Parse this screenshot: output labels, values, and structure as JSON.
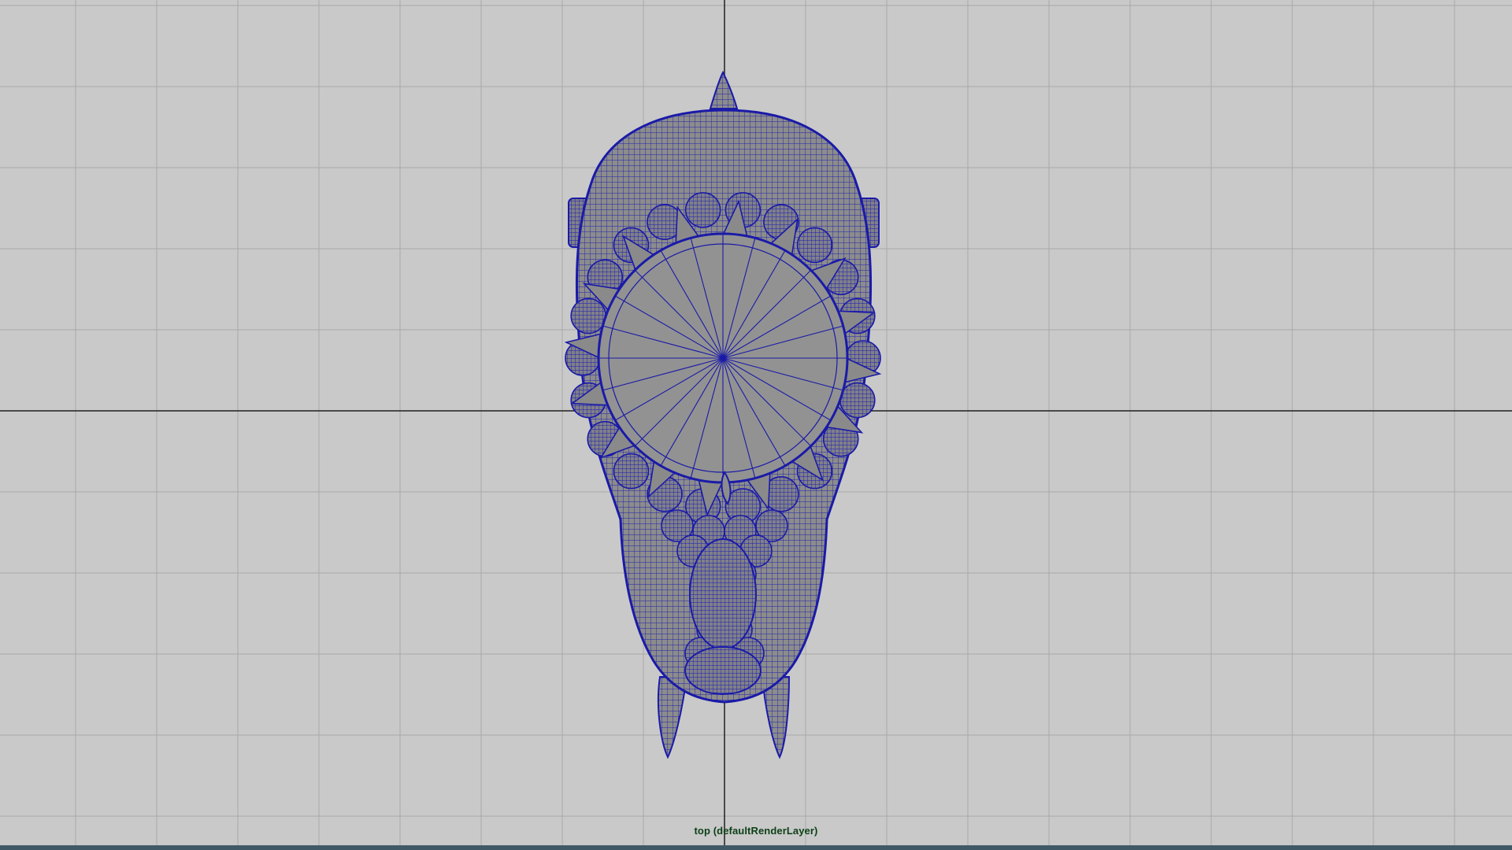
{
  "viewport": {
    "camera_label": "top (defaultRenderLayer)",
    "background_color": "#c9c9c9",
    "grid_color": "#a7a7a7",
    "axis_color": "#202020",
    "wireframe_color": "#1a1aa8",
    "mesh_fill_color": "#8a8a8a"
  }
}
